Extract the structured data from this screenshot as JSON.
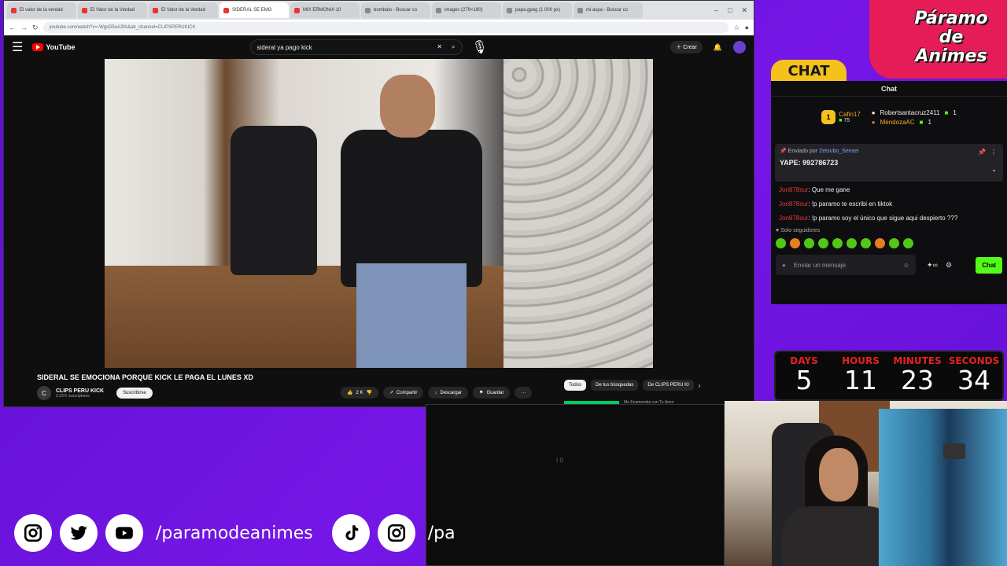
{
  "browser": {
    "tabs": [
      {
        "label": "El valor de la verdad",
        "color": "#e33"
      },
      {
        "label": "El Valor de la Verdad",
        "color": "#e33"
      },
      {
        "label": "El Valor de la Verdad",
        "color": "#e33"
      },
      {
        "label": "SIDERAL SE EMO",
        "color": "#e33",
        "active": true
      },
      {
        "label": "MIX ERMONIA 10",
        "color": "#e33"
      },
      {
        "label": "bombalo - Buscar co",
        "color": "#888"
      },
      {
        "label": "images (279×180)",
        "color": "#888"
      },
      {
        "label": "papa.gpeg (1.000 px)",
        "color": "#888"
      },
      {
        "label": "mi.aspa - Buscar co",
        "color": "#888"
      }
    ],
    "url": "youtube.com/watch?v=-WgsD5oA3fA&ab_channel=CLIPSPERUKICK",
    "window_controls": [
      "–",
      "□",
      "✕"
    ]
  },
  "youtube": {
    "logo": "YouTube",
    "search_value": "sideral ya pago kick",
    "create_label": "Crear",
    "video_title": "SIDERAL SE EMOCIONA PORQUE KICK LE PAGA EL LUNES XD",
    "channel_initial": "C",
    "channel_name": "CLIPS PERU KICK",
    "channel_subs": "2.23 K suscriptores",
    "subscribe_label": "Suscribirse",
    "likes": "2 K",
    "share_label": "Compartir",
    "download_label": "Descargar",
    "save_label": "Guardar",
    "more_label": "···",
    "chips": [
      "Todos",
      "De tus búsquedas",
      "De CLIPS PERU KI"
    ],
    "chip_arrow": "›",
    "next_label": "Me Enamoraba con Tu Amor"
  },
  "brand": {
    "line1": "Páramo",
    "line2": "de",
    "line3": "Animes"
  },
  "chat": {
    "tab_label": "CHAT",
    "header": "Chat",
    "top1_rank": "1",
    "top1_name": "Cafin17",
    "top1_count": "75",
    "top2_name": "Robertsantacruz2411",
    "top2_count": "1",
    "top3_name": "MendozaAC",
    "top3_count": "1",
    "pinned_by_prefix": "Enviado por",
    "pinned_by_user": "Zetsubo_Sensei",
    "pinned_message": "YAPE: 992786723",
    "messages": [
      {
        "user": "Jon878sur",
        "text": "Que me gane"
      },
      {
        "user": "Jon878sur",
        "text": "!p paramo te escribi en tiktok"
      },
      {
        "user": "Jon878sur",
        "text": "!p paramo soy el único que sigue aqui despierto ???"
      }
    ],
    "followers_only": "Solo seguidores",
    "input_placeholder": "Enviar un mensaje",
    "infinity": "∞",
    "send_label": "Chat"
  },
  "countdown": [
    {
      "label": "DAYS",
      "value": "5"
    },
    {
      "label": "HOURS",
      "value": "11"
    },
    {
      "label": "MINUTES",
      "value": "23"
    },
    {
      "label": "SECONDS",
      "value": "34"
    }
  ],
  "socials": {
    "handle": "/paramodeanimes",
    "handle2": "/pa"
  },
  "black_panel": {
    "center_text": "I  0"
  }
}
